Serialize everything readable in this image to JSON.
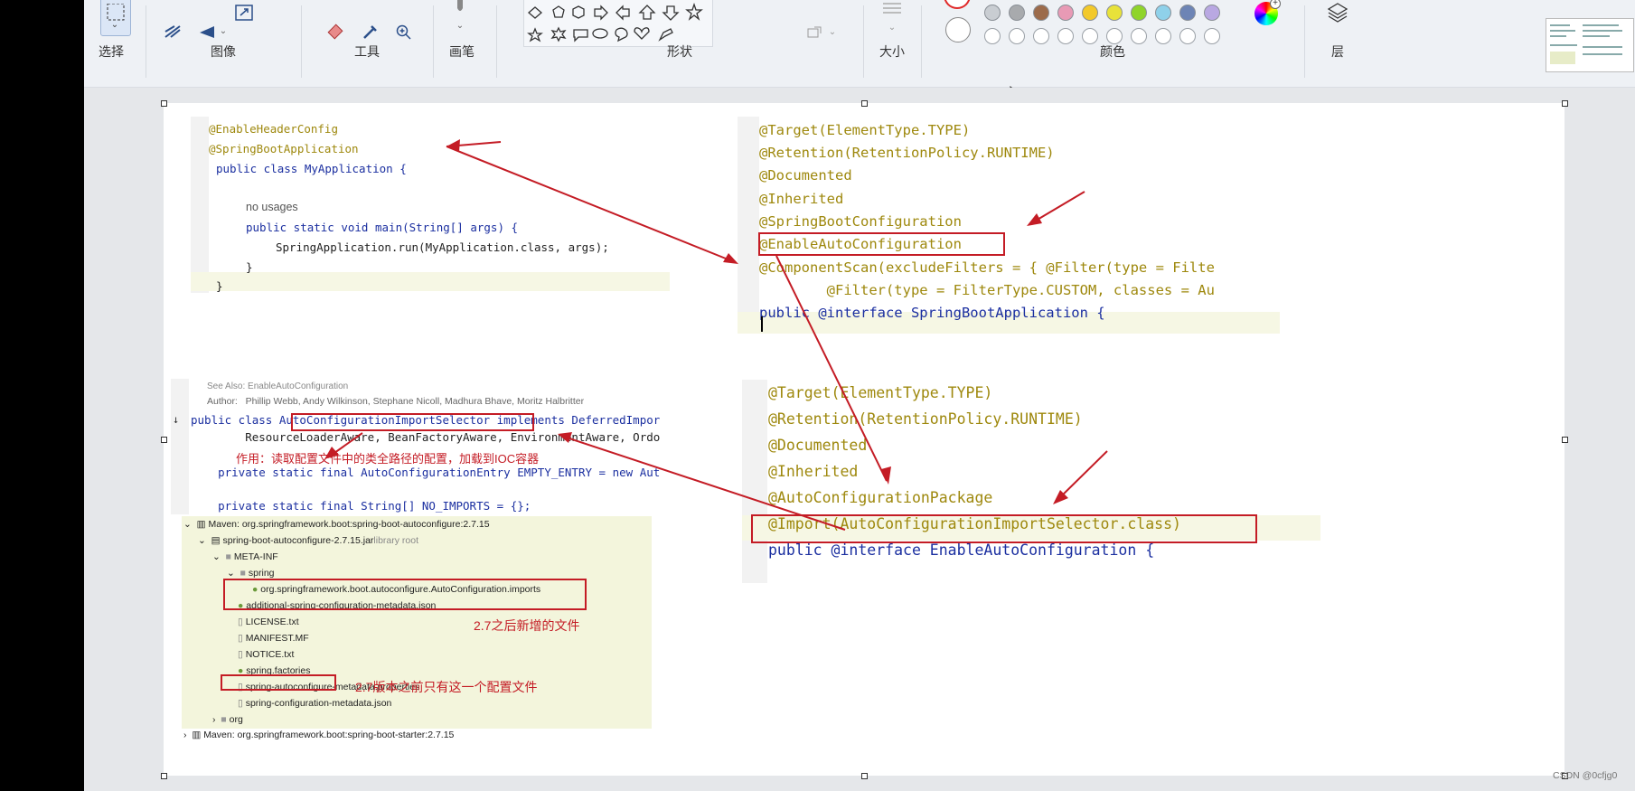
{
  "ribbon": {
    "groups": [
      "选择",
      "图像",
      "工具",
      "画笔",
      "形状",
      "大小",
      "颜色",
      "层"
    ],
    "palette": [
      "#c9cdd2",
      "#a8aaad",
      "#9c6b4b",
      "#e89ab5",
      "#f3c92a",
      "#e8e23a",
      "#8fd42a",
      "#8fd1ea",
      "#6d84b5",
      "#b9a8e2"
    ]
  },
  "code_top_left": [
    "@EnableHeaderConfig",
    "@SpringBootApplication",
    "public class MyApplication {",
    "no usages",
    "public static void main(String[] args) {",
    "SpringApplication.run(MyApplication.class, args);",
    "}",
    "}"
  ],
  "code_top_right": [
    "@Target(ElementType.TYPE)",
    "@Retention(RetentionPolicy.RUNTIME)",
    "@Documented",
    "@Inherited",
    "@SpringBootConfiguration",
    "@EnableAutoConfiguration",
    "@ComponentScan(excludeFilters = { @Filter(type = Filte",
    "        @Filter(type = FilterType.CUSTOM, classes = Au",
    "public @interface SpringBootApplication {"
  ],
  "code_mid_left": {
    "see_also": "See Also: EnableAutoConfiguration",
    "author": "Author:   Phillip Webb, Andy Wilkinson, Stephane Nicoll, Madhura Bhave, Moritz Halbritter",
    "line1": "public class AutoConfigurationImportSelector implements DeferredImpor",
    "line2": "        ResourceLoaderAware, BeanFactoryAware, EnvironmentAware, Ordo",
    "note": "作用：读取配置文件中的类全路径的配置，加载到IOC容器",
    "line3": "    private static final AutoConfigurationEntry EMPTY_ENTRY = new Aut",
    "line4": "    private static final String[] NO_IMPORTS = {};"
  },
  "code_bottom_right": [
    "@Target(ElementType.TYPE)",
    "@Retention(RetentionPolicy.RUNTIME)",
    "@Documented",
    "@Inherited",
    "@AutoConfigurationPackage",
    "@Import(AutoConfigurationImportSelector.class)",
    "public @interface EnableAutoConfiguration {"
  ],
  "tree": {
    "maven1": "Maven: org.springframework.boot:spring-boot-autoconfigure:2.7.15",
    "jar": "spring-boot-autoconfigure-2.7.15.jar",
    "jar_suffix": "library root",
    "meta_inf": "META-INF",
    "spring": "spring",
    "imports": "org.springframework.boot.autoconfigure.AutoConfiguration.imports",
    "metadata_json": "additional-spring-configuration-metadata.json",
    "license": "LICENSE.txt",
    "manifest": "MANIFEST.MF",
    "notice": "NOTICE.txt",
    "factories": "spring.factories",
    "props": "spring-autoconfigure-metadata.properties",
    "config_json": "spring-configuration-metadata.json",
    "org": "org",
    "maven2": "Maven: org.springframework.boot:spring-boot-starter:2.7.15",
    "note_new": "2.7之后新增的文件",
    "note_old": "2.7版本之前只有这一个配置文件"
  },
  "watermark": "CSDN @0cfjg0"
}
